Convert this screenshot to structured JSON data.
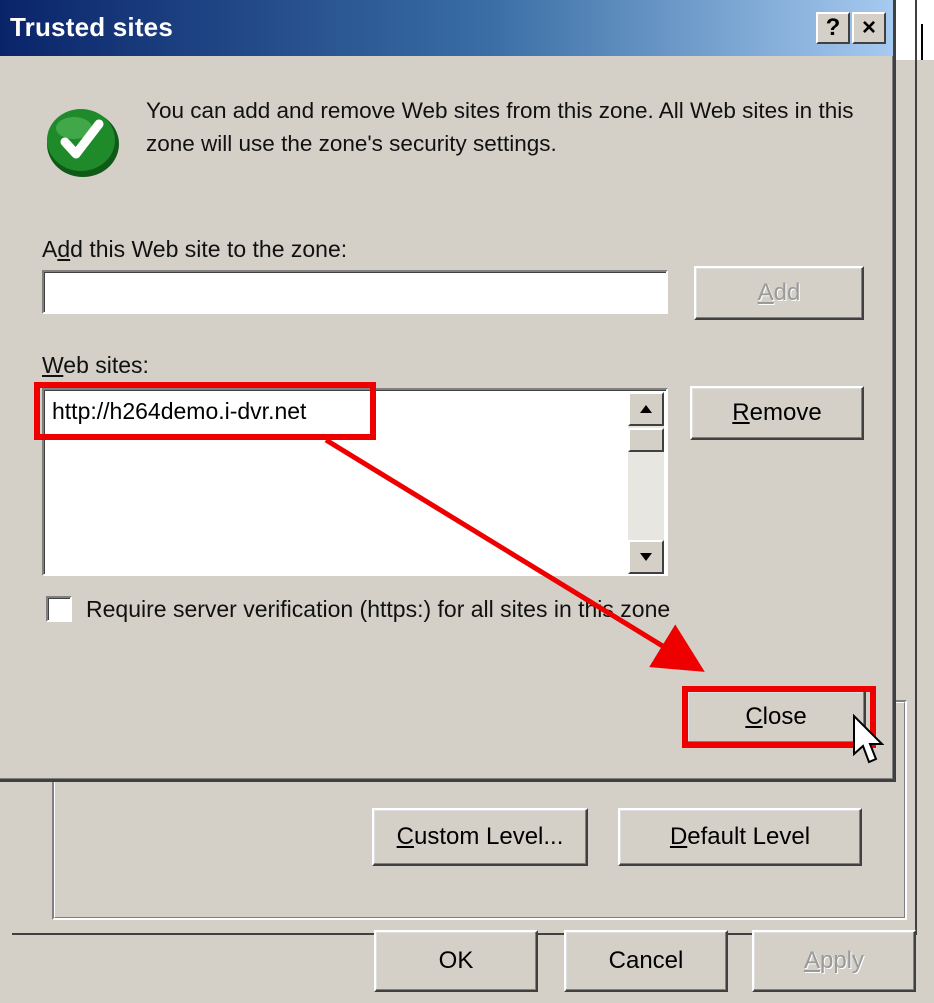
{
  "dialog": {
    "title": "Trusted sites",
    "help_button": "?",
    "close_x_button": "×",
    "info_text": "You can add and remove Web sites from this zone. All Web sites in this zone will use the zone's security settings.",
    "add_label_prefix": "A",
    "add_label_mnemonic": "d",
    "add_label_suffix": "d this Web site to the zone:",
    "add_input_value": "",
    "add_button_mnemonic": "A",
    "add_button_suffix": "dd",
    "web_sites_label_mnemonic": "W",
    "web_sites_label_suffix": "eb sites:",
    "web_sites": [
      "http://h264demo.i-dvr.net"
    ],
    "remove_button_mnemonic": "R",
    "remove_button_suffix": "emove",
    "require_label_prefix": "Require ",
    "require_label_mnemonic": "s",
    "require_label_suffix": "erver verification (https:) for all sites in this zone",
    "require_checked": false,
    "close_button_mnemonic": "C",
    "close_button_suffix": "lose"
  },
  "parent": {
    "custom_level_mnemonic": "C",
    "custom_level_suffix": "ustom Level...",
    "default_level_mnemonic": "D",
    "default_level_suffix": "efault Level",
    "ok_label": "OK",
    "cancel_label": "Cancel",
    "apply_mnemonic": "A",
    "apply_suffix": "pply"
  },
  "icons": {
    "info": "green-checkmark-icon",
    "scroll_up": "arrow-up-icon",
    "scroll_down": "arrow-down-icon",
    "cursor": "mouse-pointer-icon"
  },
  "colors": {
    "face": "#d4d0c8",
    "title_start": "#0a246a",
    "title_end": "#a6caf0",
    "annotation": "#ee0000",
    "check_green": "#1f8a2a"
  }
}
